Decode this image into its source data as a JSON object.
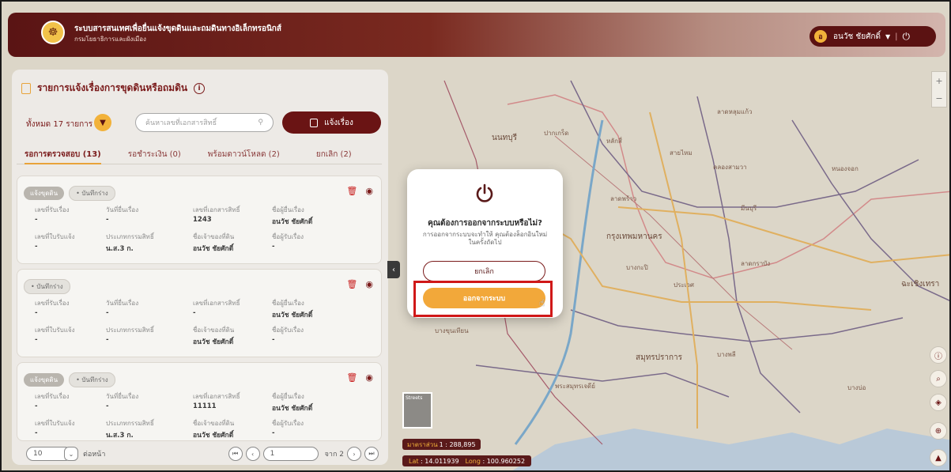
{
  "header": {
    "title": "ระบบสารสนเทศเพื่อยื่นแจ้งขุดดินและถมดินทางอิเล็กทรอนิกส์",
    "subtitle": "กรมโยธาธิการและผังเมือง",
    "user_initial": "อ",
    "user_name": "อนวัช ชัยศักดิ์"
  },
  "panel": {
    "title": "รายการแจ้งเรื่องการขุดดินหรือถมดิน",
    "total": "ทั้งหมด 17 รายการ",
    "search_placeholder": "ค้นหาเลขที่เอกสารสิทธิ์",
    "report_button": "แจ้งเรื่อง",
    "tabs": [
      "รอการตรวจสอบ (13)",
      "รอชำระเงิน (0)",
      "พร้อมดาวน์โหลด (2)",
      "ยกเลิก (2)"
    ],
    "cards": [
      {
        "tag": "แจ้งขุดดิน",
        "status": "• บันทึกร่าง",
        "fields": [
          {
            "label": "เลขที่รับเรื่อง",
            "value": "-"
          },
          {
            "label": "วันที่ยื่นเรื่อง",
            "value": "-"
          },
          {
            "label": "เลขที่เอกสารสิทธิ์",
            "value": "1243"
          },
          {
            "label": "ชื่อผู้ยื่นเรื่อง",
            "value": "อนวัช ชัยศักดิ์"
          },
          {
            "label": "เลขที่ใบรับแจ้ง",
            "value": "-"
          },
          {
            "label": "ประเภทกรรมสิทธิ์",
            "value": "น.ส.3 ก."
          },
          {
            "label": "ชื่อเจ้าของที่ดิน",
            "value": "อนวัช ชัยศักดิ์"
          },
          {
            "label": "ชื่อผู้รับเรื่อง",
            "value": "-"
          }
        ]
      },
      {
        "tag": "",
        "status": "• บันทึกร่าง",
        "fields": [
          {
            "label": "เลขที่รับเรื่อง",
            "value": "-"
          },
          {
            "label": "วันที่ยื่นเรื่อง",
            "value": "-"
          },
          {
            "label": "เลขที่เอกสารสิทธิ์",
            "value": "-"
          },
          {
            "label": "ชื่อผู้ยื่นเรื่อง",
            "value": "อนวัช ชัยศักดิ์"
          },
          {
            "label": "เลขที่ใบรับแจ้ง",
            "value": "-"
          },
          {
            "label": "ประเภทกรรมสิทธิ์",
            "value": "-"
          },
          {
            "label": "ชื่อเจ้าของที่ดิน",
            "value": "อนวัช ชัยศักดิ์"
          },
          {
            "label": "ชื่อผู้รับเรื่อง",
            "value": "-"
          }
        ]
      },
      {
        "tag": "แจ้งขุดดิน",
        "status": "• บันทึกร่าง",
        "fields": [
          {
            "label": "เลขที่รับเรื่อง",
            "value": "-"
          },
          {
            "label": "วันที่ยื่นเรื่อง",
            "value": "-"
          },
          {
            "label": "เลขที่เอกสารสิทธิ์",
            "value": "11111"
          },
          {
            "label": "ชื่อผู้ยื่นเรื่อง",
            "value": "อนวัช ชัยศักดิ์"
          },
          {
            "label": "เลขที่ใบรับแจ้ง",
            "value": "-"
          },
          {
            "label": "ประเภทกรรมสิทธิ์",
            "value": "น.ส.3 ก."
          },
          {
            "label": "ชื่อเจ้าของที่ดิน",
            "value": "อนวัช ชัยศักดิ์"
          },
          {
            "label": "ชื่อผู้รับเรื่อง",
            "value": "-"
          }
        ]
      }
    ],
    "pager": {
      "page_size": "10",
      "per_page_label": "ต่อหน้า",
      "current_page": "1",
      "total_pages_label": "จาก 2"
    }
  },
  "modal": {
    "question": "คุณต้องการออกจากระบบหรือไม่?",
    "description": "การออกจากระบบจะทำให้ คุณต้องล็อกอินใหม่ ในครั้งถัดไป",
    "cancel": "ยกเลิก",
    "logout": "ออกจากระบบ"
  },
  "map": {
    "labels": [
      "นนทบุรี",
      "ปากเกร็ด",
      "หลักสี่",
      "สายไหม",
      "ลาดกราบัง",
      "คลองสามวา",
      "มีนบุรี",
      "กรุงเทพมหานคร",
      "บางกะปิ",
      "ประเวศ",
      "ฉะเชิงเทรา",
      "สมุทรปราการ",
      "บางพลี",
      "บางบ่อ",
      "พระสมุทรเจดีย์",
      "บางขุนเทียน",
      "ลาดพร้าว",
      "หนองจอก",
      "ลาดหลุมแก้ว"
    ],
    "thumb_label": "Streets",
    "scale_key": "มาตราส่วน",
    "scale_value": "1 : 288,895",
    "lat_key": "Lat",
    "lat_value": "14.011939",
    "long_key": "Long",
    "long_value": "100.960252"
  }
}
